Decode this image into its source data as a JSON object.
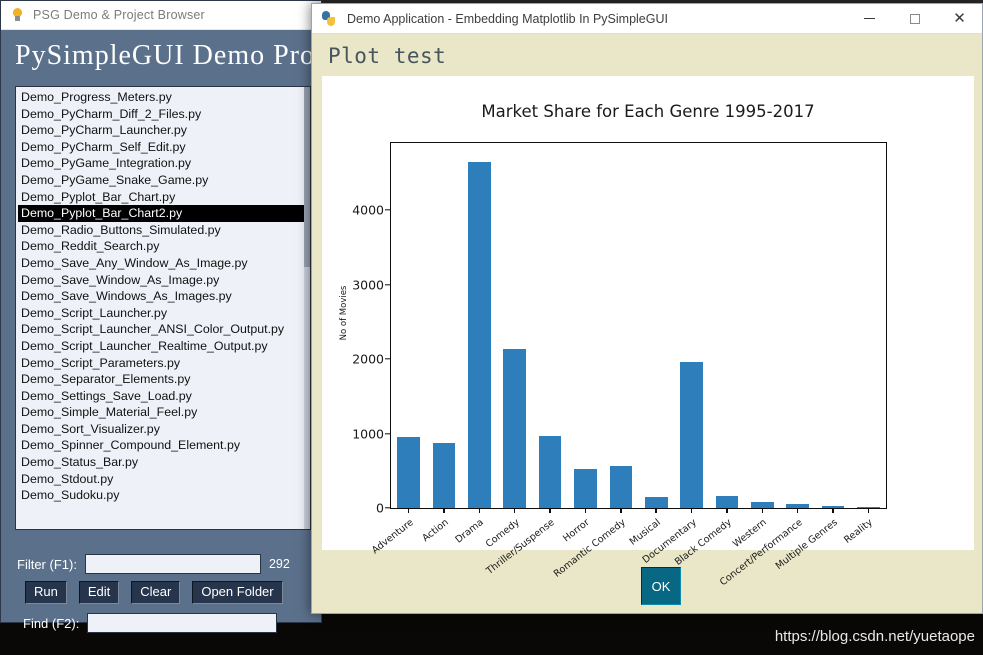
{
  "browser_window": {
    "titlebar": {
      "icon": "lightbulb-icon",
      "title": "PSG Demo & Project Browser"
    },
    "heading": "PySimpleGUI Demo Prog",
    "file_list": {
      "items": [
        "Demo_Progress_Meters.py",
        "Demo_PyCharm_Diff_2_Files.py",
        "Demo_PyCharm_Launcher.py",
        "Demo_PyCharm_Self_Edit.py",
        "Demo_PyGame_Integration.py",
        "Demo_PyGame_Snake_Game.py",
        "Demo_Pyplot_Bar_Chart.py",
        "Demo_Pyplot_Bar_Chart2.py",
        "Demo_Radio_Buttons_Simulated.py",
        "Demo_Reddit_Search.py",
        "Demo_Save_Any_Window_As_Image.py",
        "Demo_Save_Window_As_Image.py",
        "Demo_Save_Windows_As_Images.py",
        "Demo_Script_Launcher.py",
        "Demo_Script_Launcher_ANSI_Color_Output.py",
        "Demo_Script_Launcher_Realtime_Output.py",
        "Demo_Script_Parameters.py",
        "Demo_Separator_Elements.py",
        "Demo_Settings_Save_Load.py",
        "Demo_Simple_Material_Feel.py",
        "Demo_Sort_Visualizer.py",
        "Demo_Spinner_Compound_Element.py",
        "Demo_Status_Bar.py",
        "Demo_Stdout.py",
        "Demo_Sudoku.py"
      ],
      "selected_index": 7
    },
    "filter": {
      "label": "Filter (F1):",
      "value": "",
      "placeholder": ""
    },
    "count": "292",
    "buttons": [
      {
        "label": "Run"
      },
      {
        "label": "Edit"
      },
      {
        "label": "Clear"
      },
      {
        "label": "Open Folder"
      }
    ],
    "find": {
      "label": "Find (F2):",
      "value": "",
      "placeholder": ""
    }
  },
  "dialog": {
    "titlebar": {
      "icon": "python-icon",
      "title": "Demo Application - Embedding Matplotlib In PySimpleGUI",
      "minimize": "minimize-icon",
      "maximize": "maximize-icon",
      "close": "close-icon"
    },
    "plot_label": "Plot test",
    "ok_button": "OK"
  },
  "watermark": "https://blog.csdn.net/yuetaope",
  "colors": {
    "psg_background": "#5b708b",
    "dialog_background": "#eae7c8",
    "bar_color": "#2e7ebb",
    "ok_button": "#086782",
    "psg_button": "#26344c",
    "selection": "#000000"
  },
  "chart_data": {
    "type": "bar",
    "title": "Market Share for Each Genre 1995-2017",
    "xlabel": "",
    "ylabel": "No of Movies",
    "ylim": [
      0,
      4900
    ],
    "yticks": [
      0,
      1000,
      2000,
      3000,
      4000
    ],
    "grid": false,
    "legend": null,
    "categories": [
      "Adventure",
      "Action",
      "Drama",
      "Comedy",
      "Thriller/Suspense",
      "Horror",
      "Romantic Comedy",
      "Musical",
      "Documentary",
      "Black Comedy",
      "Western",
      "Concert/Performance",
      "Multiple Genres",
      "Reality"
    ],
    "values": [
      960,
      870,
      4640,
      2130,
      965,
      520,
      560,
      145,
      1960,
      160,
      75,
      60,
      30,
      8
    ],
    "bar_color": "#2e7ebb"
  }
}
